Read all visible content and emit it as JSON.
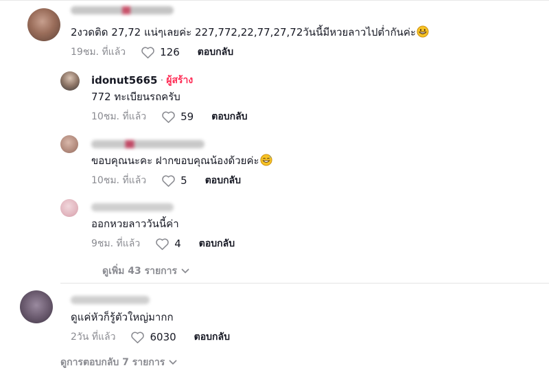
{
  "comments": [
    {
      "text": "2งวดติด 27,72 แน่ๆเลยค่ะ 227,772,22,77,27,72วันนี้มีหวยลาวไปต่ำกันค่ะ",
      "time": "19ชม. ที่แล้ว",
      "likes": "126",
      "reply_label": "ตอบกลับ",
      "emoji": "grinning-face-icon"
    },
    {
      "author": "idonut5665",
      "separator": "·",
      "badge": "ผู้สร้าง",
      "text": "772 ทะเบียนรถครับ",
      "time": "10ชม. ที่แล้ว",
      "likes": "59",
      "reply_label": "ตอบกลับ"
    },
    {
      "text": "ขอบคุณนะคะ ฝากขอบคุณน้องด้วยค่ะ",
      "time": "10ชม. ที่แล้ว",
      "likes": "5",
      "reply_label": "ตอบกลับ",
      "emoji": "sweat-smile-icon"
    },
    {
      "text": "ออกหวยลาววันนี้ค่า",
      "time": "9ชม. ที่แล้ว",
      "likes": "4",
      "reply_label": "ตอบกลับ"
    },
    {
      "text": "ดูแค่หัวก็รู้ตัวใหญ่มากก",
      "time": "2วัน ที่แล้ว",
      "likes": "6030",
      "reply_label": "ตอบกลับ"
    }
  ],
  "view_more_replies": "ดูเพิ่ม 43 รายการ",
  "view_replies": "ดูการตอบกลับ 7 รายการ",
  "colors": {
    "accent": "#fe2c55",
    "muted": "#8a8b91",
    "text": "#161823"
  }
}
